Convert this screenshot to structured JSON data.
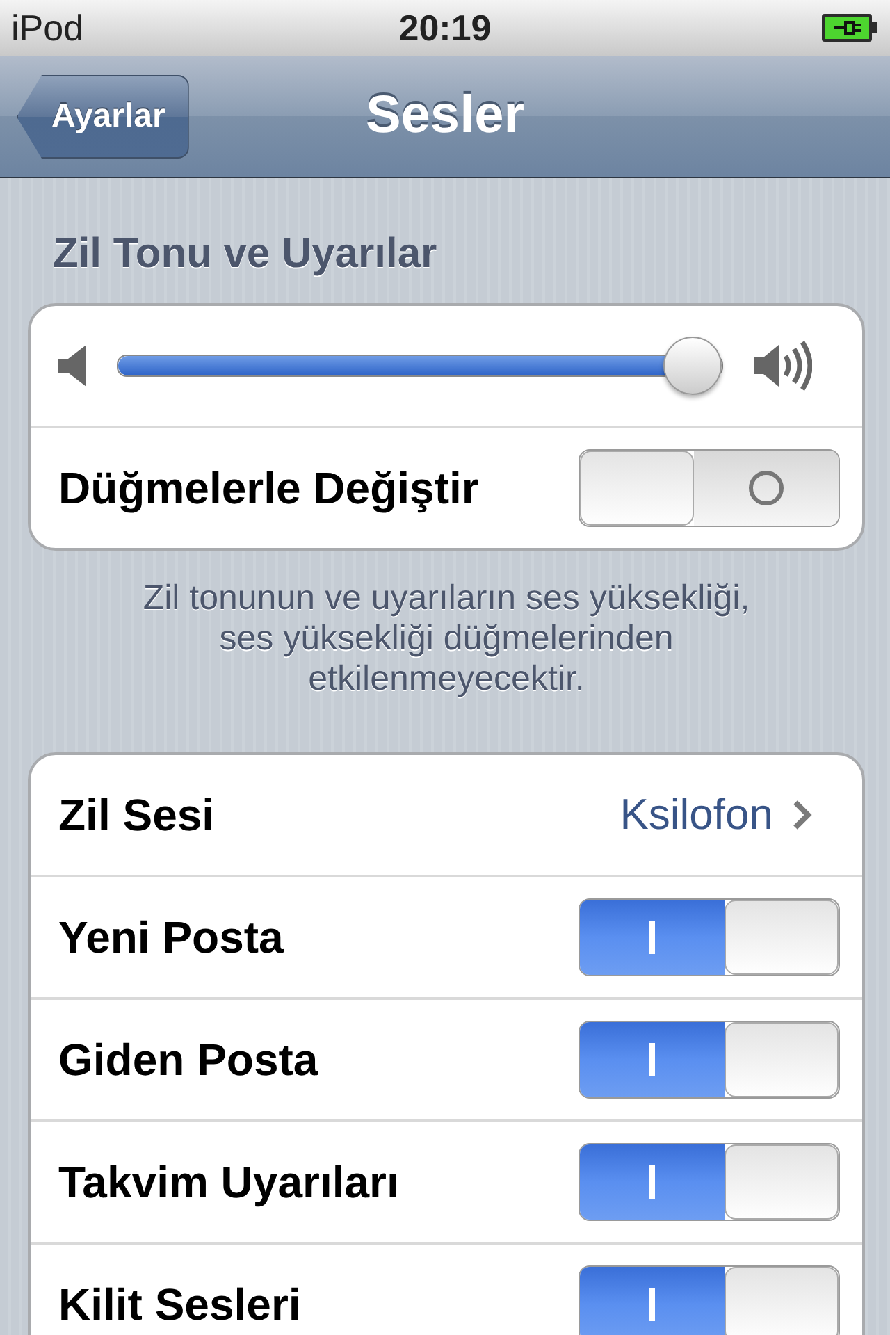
{
  "status_bar": {
    "carrier": "iPod",
    "time": "20:19"
  },
  "nav": {
    "back": "Ayarlar",
    "title": "Sesler"
  },
  "ringer": {
    "header": "Zil Tonu ve Uyarılar",
    "volume": {
      "level": 0.95
    },
    "toggle": {
      "label": "Düğmelerle Değiştir",
      "on": false
    },
    "footer": "Zil tonunun ve uyarıların ses yüksekliği, ses yüksekliği düğmelerinden etkilenmeyecektir."
  },
  "sounds": [
    {
      "kind": "link",
      "label": "Zil Sesi",
      "value": "Ksilofon"
    },
    {
      "kind": "toggle",
      "label": "Yeni Posta",
      "on": true
    },
    {
      "kind": "toggle",
      "label": "Giden Posta",
      "on": true
    },
    {
      "kind": "toggle",
      "label": "Takvim Uyarıları",
      "on": true
    },
    {
      "kind": "toggle",
      "label": "Kilit Sesleri",
      "on": true
    }
  ]
}
